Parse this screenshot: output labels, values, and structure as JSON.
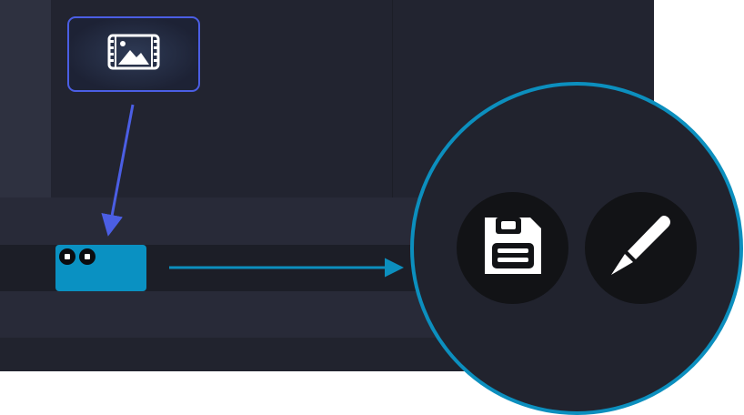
{
  "editor": {
    "media_thumbnail_icon": "image-film-icon",
    "clip_handles": [
      "clip-handle-icon",
      "clip-handle-icon"
    ]
  },
  "zoom": {
    "buttons": [
      {
        "icon": "save-icon"
      },
      {
        "icon": "pen-icon"
      }
    ]
  },
  "colors": {
    "background": "#21232e",
    "panel": "#2e3140",
    "accent_blue": "#4b5ee4",
    "clip": "#0a91c2",
    "zoom_border": "#0c8fbe",
    "button_bg": "#121316"
  }
}
